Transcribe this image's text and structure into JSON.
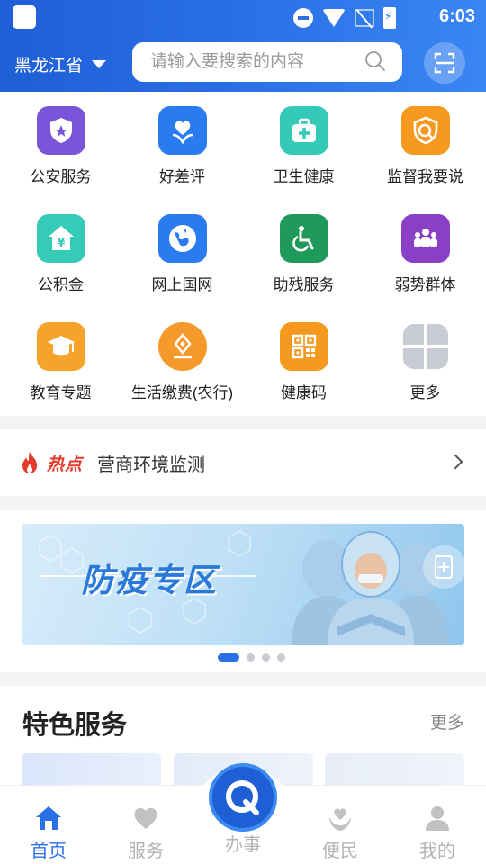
{
  "status_bar": {
    "time": "6:03"
  },
  "header": {
    "region": "黑龙江省",
    "search_placeholder": "请输入要搜索的内容"
  },
  "services": [
    {
      "label": "公安服务",
      "icon": "police-shield-icon",
      "color": "#7b55d9"
    },
    {
      "label": "好差评",
      "icon": "heart-flower-icon",
      "color": "#2a7af0"
    },
    {
      "label": "卫生健康",
      "icon": "medical-kit-icon",
      "color": "#35c9b8"
    },
    {
      "label": "监督我要说",
      "icon": "supervise-shield-icon",
      "color": "#f59a1f"
    },
    {
      "label": "公积金",
      "icon": "housing-fund-icon",
      "color": "#35cbb7"
    },
    {
      "label": "网上国网",
      "icon": "globe-icon",
      "color": "#2a7af0"
    },
    {
      "label": "助残服务",
      "icon": "wheelchair-icon",
      "color": "#1f9a5a"
    },
    {
      "label": "弱势群体",
      "icon": "group-people-icon",
      "color": "#8a3fc7"
    },
    {
      "label": "教育专题",
      "icon": "graduation-cap-icon",
      "color": "#f5a32a"
    },
    {
      "label": "生活缴费(农行)",
      "icon": "pen-payment-icon",
      "color": "#f5992a"
    },
    {
      "label": "健康码",
      "icon": "qr-code-icon",
      "color": "#f59a1f"
    },
    {
      "label": "更多",
      "icon": "more-grid-icon",
      "color": "#c5c9d2"
    }
  ],
  "hot": {
    "tag": "热点",
    "text": "营商环境监测"
  },
  "banner": {
    "title": "防疫专区",
    "page_count": 4,
    "active_page": 1
  },
  "featured": {
    "title": "特色服务",
    "more": "更多"
  },
  "tabs": [
    {
      "label": "首页",
      "icon": "home-icon",
      "active": true
    },
    {
      "label": "服务",
      "icon": "heart-icon",
      "active": false
    },
    {
      "label": "办事",
      "icon": "center-q-icon",
      "active": false
    },
    {
      "label": "便民",
      "icon": "hand-heart-icon",
      "active": false
    },
    {
      "label": "我的",
      "icon": "person-icon",
      "active": false
    }
  ],
  "colors": {
    "primary": "#2a6fe6",
    "hot_red": "#e53b2c"
  }
}
